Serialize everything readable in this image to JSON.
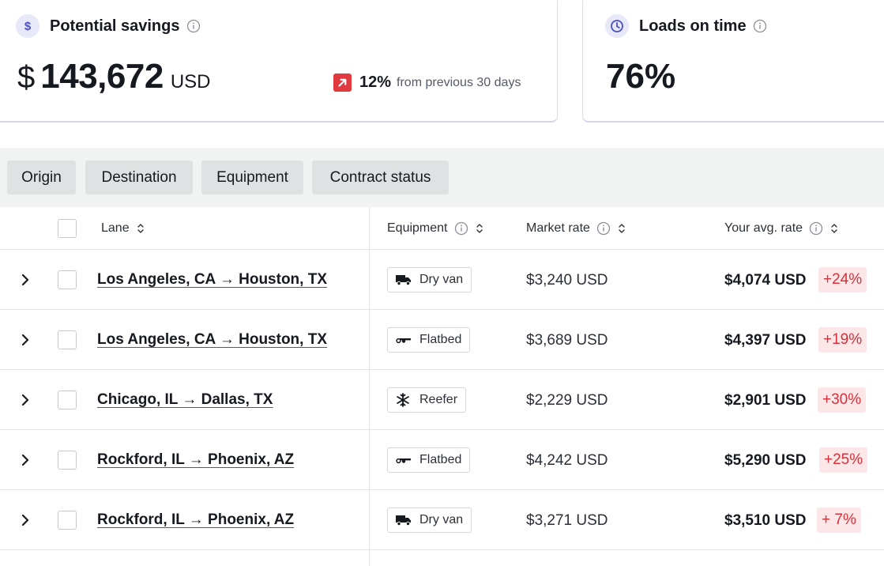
{
  "savings_card": {
    "icon": "dollar-icon",
    "icon_glyph": "$",
    "title": "Potential savings",
    "currency_symbol": "$",
    "amount": "143,672",
    "unit": "USD",
    "trend_icon": "trend-up-icon",
    "trend_pct": "12%",
    "trend_text": "from previous 30 days"
  },
  "ontime_card": {
    "icon": "clock-icon",
    "title": "Loads on time",
    "value": "76%"
  },
  "filters": [
    "Origin",
    "Destination",
    "Equipment",
    "Contract status"
  ],
  "table": {
    "columns": {
      "lane": "Lane",
      "equipment": "Equipment",
      "market_rate": "Market rate",
      "avg_rate": "Your avg. rate"
    },
    "rows": [
      {
        "lane": "Los Angeles, CA → Houston, TX",
        "equipment": "Dry van",
        "equipment_icon": "truck-icon",
        "market_rate": "$3,240 USD",
        "avg_rate": "$4,074 USD",
        "delta": "+24%"
      },
      {
        "lane": "Los Angeles, CA → Houston, TX",
        "equipment": "Flatbed",
        "equipment_icon": "flatbed-icon",
        "market_rate": "$3,689 USD",
        "avg_rate": "$4,397 USD",
        "delta": "+19%"
      },
      {
        "lane": "Chicago, IL → Dallas, TX",
        "equipment": "Reefer",
        "equipment_icon": "snowflake-icon",
        "market_rate": "$2,229 USD",
        "avg_rate": "$2,901 USD",
        "delta": "+30%"
      },
      {
        "lane": "Rockford, IL → Phoenix, AZ",
        "equipment": "Flatbed",
        "equipment_icon": "flatbed-icon",
        "market_rate": "$4,242 USD",
        "avg_rate": "$5,290 USD",
        "delta": "+25%"
      },
      {
        "lane": "Rockford, IL → Phoenix, AZ",
        "equipment": "Dry van",
        "equipment_icon": "truck-icon",
        "market_rate": "$3,271 USD",
        "avg_rate": "$3,510 USD",
        "delta": "+ 7%"
      }
    ]
  },
  "colors": {
    "accent_icon_bg": "#e7e8f8",
    "accent_icon": "#4b4fc4",
    "trend_red": "#e03a3e",
    "delta_bg": "#fbe7e8",
    "delta_text": "#d8303a"
  }
}
